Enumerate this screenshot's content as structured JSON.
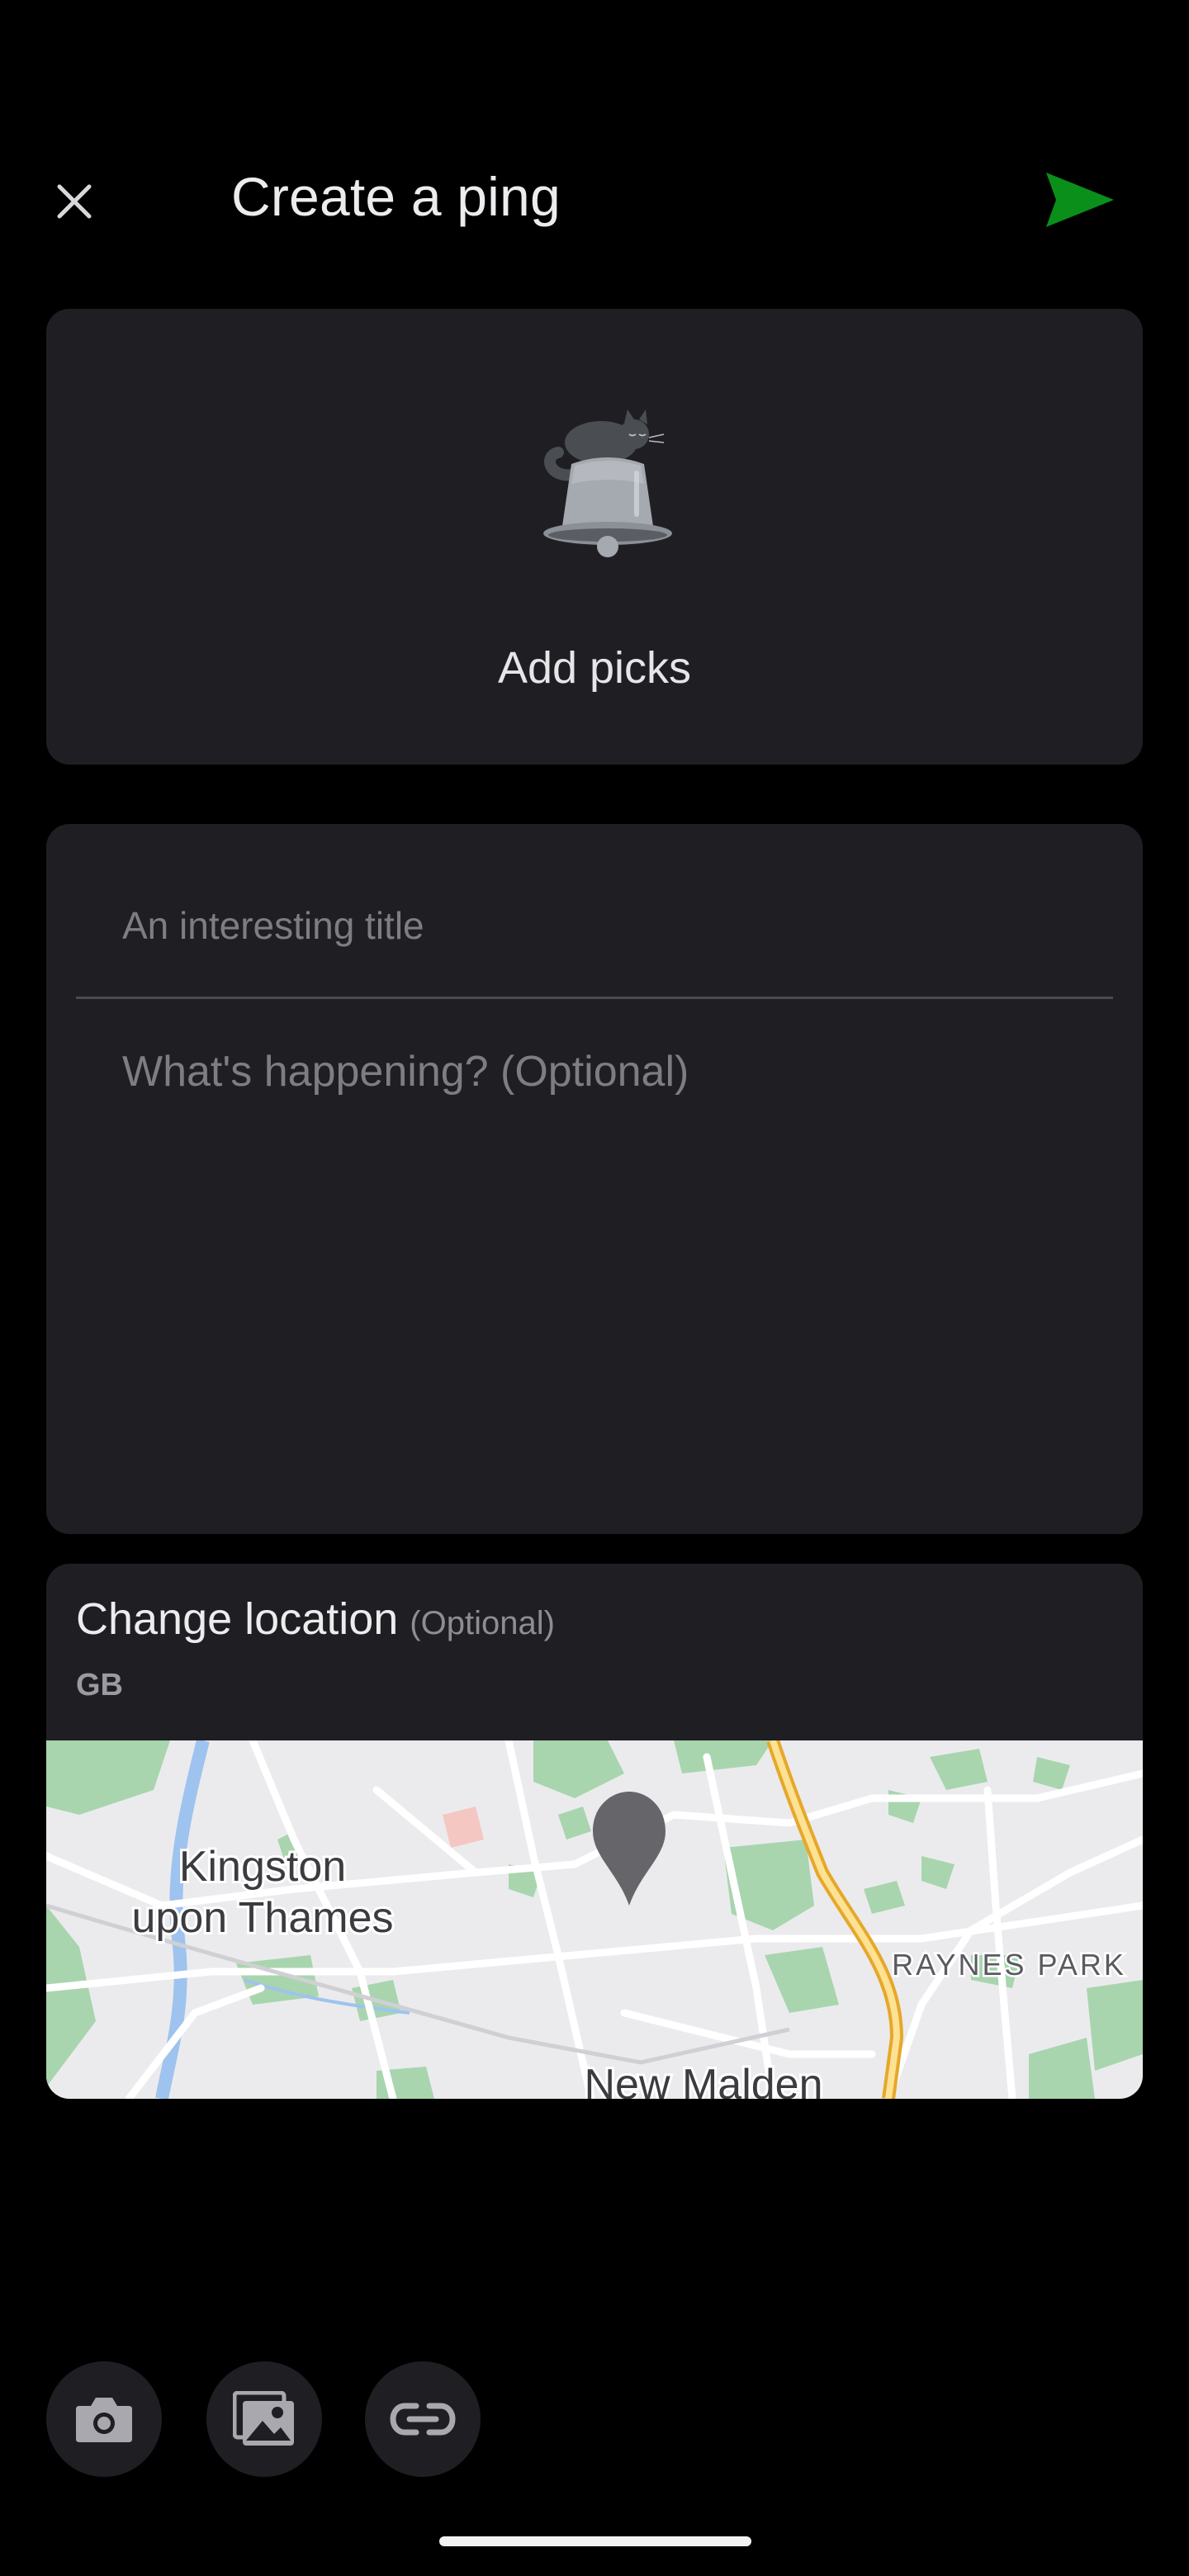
{
  "header": {
    "title": "Create a ping",
    "close_icon": "close-icon",
    "send_icon": "send-icon",
    "accent": "#0a8f1a"
  },
  "picks": {
    "label": "Add picks",
    "illustration": "sleeping-cat-on-bell"
  },
  "compose": {
    "title_placeholder": "An interesting title",
    "title_value": "",
    "body_placeholder": "What's happening? (Optional)",
    "body_value": ""
  },
  "location": {
    "title": "Change location",
    "optional_label": "(Optional)",
    "country": "GB",
    "map_labels": {
      "kingston_line1": "Kingston",
      "kingston_line2": "upon Thames",
      "raynes_park": "RAYNES PARK",
      "new_malden": "New Malden"
    }
  },
  "toolbar": {
    "camera_icon": "camera-icon",
    "gallery_icon": "gallery-icon",
    "link_icon": "link-icon"
  },
  "colors": {
    "background": "#000000",
    "card": "#1f1f23",
    "placeholder": "#7d7d83"
  }
}
